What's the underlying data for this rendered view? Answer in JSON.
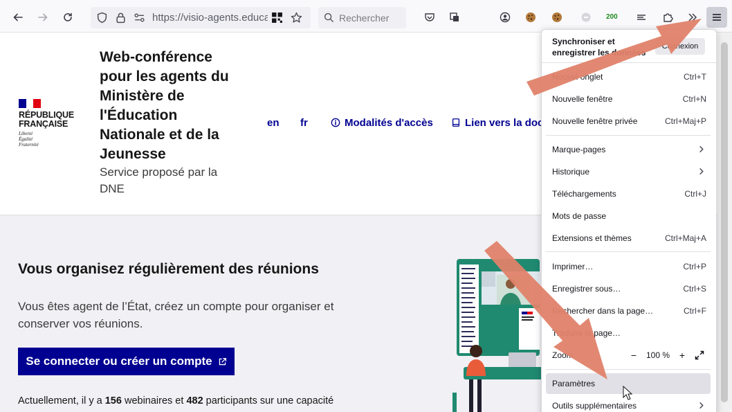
{
  "toolbar": {
    "url": "https://visio-agents.education.fr",
    "search_placeholder": "Rechercher",
    "counter": "200"
  },
  "header": {
    "republique": "RÉPUBLIQUE FRANÇAISE",
    "motto": [
      "Liberté",
      "Égalité",
      "Fraternité"
    ],
    "title": "Web-conférence pour les agents du Ministère de l'Éducation Nationale et de la Jeunesse",
    "subtitle": "Service proposé par la DNE",
    "nav": {
      "en": "en",
      "fr": "fr",
      "access": "Modalités d'accès",
      "doc": "Lien vers la documentation"
    }
  },
  "main": {
    "heading": "Vous organisez régulièrement des réunions",
    "lead": "Vous êtes agent de l’État, créez un compte pour organiser et conserver vos réunions.",
    "cta": "Se connecter ou créer un compte",
    "stats": {
      "prefix": "Actuellement, il y a ",
      "webinars": "156",
      "mid1": " webinaires et ",
      "participants": "482",
      "mid2": " participants sur une capacité"
    }
  },
  "menu": {
    "sync_text": "Synchroniser et enregistrer les données",
    "sync_button": "Connexion",
    "items": [
      {
        "label": "Nouvel onglet",
        "shortcut": "Ctrl+T"
      },
      {
        "label": "Nouvelle fenêtre",
        "shortcut": "Ctrl+N"
      },
      {
        "label": "Nouvelle fenêtre privée",
        "shortcut": "Ctrl+Maj+P"
      },
      {
        "label": "Marque-pages",
        "shortcut": ""
      },
      {
        "label": "Historique",
        "shortcut": ""
      },
      {
        "label": "Téléchargements",
        "shortcut": "Ctrl+J"
      },
      {
        "label": "Mots de passe",
        "shortcut": ""
      },
      {
        "label": "Extensions et thèmes",
        "shortcut": "Ctrl+Maj+A"
      },
      {
        "label": "Imprimer…",
        "shortcut": "Ctrl+P"
      },
      {
        "label": "Enregistrer sous…",
        "shortcut": "Ctrl+S"
      },
      {
        "label": "Rechercher dans la page…",
        "shortcut": "Ctrl+F"
      },
      {
        "label": "Traduire la page…",
        "shortcut": ""
      },
      {
        "label": "Zoom",
        "shortcut": ""
      },
      {
        "label": "Paramètres",
        "shortcut": ""
      },
      {
        "label": "Outils supplémentaires",
        "shortcut": ""
      }
    ],
    "zoom_value": "100 %",
    "zoom_minus": "−",
    "zoom_plus": "+"
  },
  "colors": {
    "dsfr_blue": "#000091",
    "flag_red": "#e1000f",
    "annotation_arrow": "#e0826a",
    "illustration_green": "#1f8a70"
  }
}
